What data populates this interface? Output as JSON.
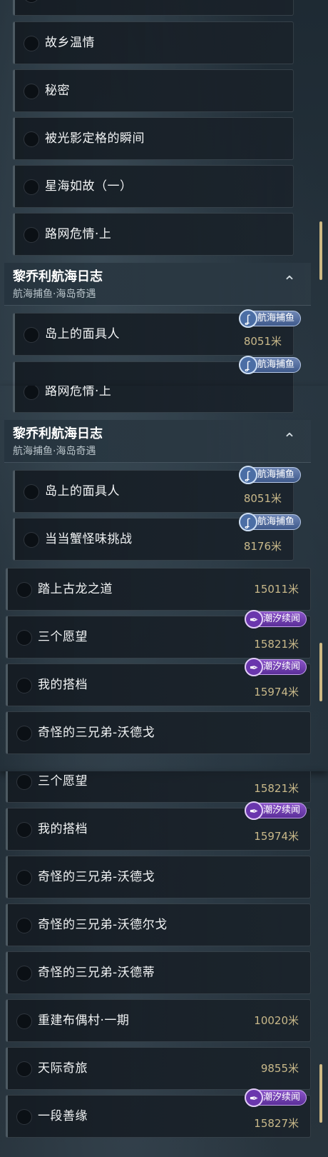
{
  "colors": {
    "accent_gold": "#c9b98a",
    "tide_purple": "#7a45b8",
    "fish_blue": "#4b6ea5"
  },
  "badges": {
    "fish": "航海捕鱼",
    "tide": "潮汐续闻",
    "fish_icon": "hook-icon",
    "tide_icon": "feather-icon"
  },
  "panel1": {
    "rows": [
      {
        "label": "故乡温情"
      },
      {
        "label": "秘密"
      },
      {
        "label": "被光影定格的瞬间"
      },
      {
        "label": "星海如故（一）"
      },
      {
        "label": "路网危情·上"
      }
    ],
    "section": {
      "title": "黎乔利航海日志",
      "subtitle": "航海捕鱼·海岛奇遇"
    },
    "after": [
      {
        "label": "岛上的面具人",
        "distance": "8051米"
      }
    ]
  },
  "panel2": {
    "rows": [
      {
        "label": "路网危情·上"
      }
    ],
    "section": {
      "title": "黎乔利航海日志",
      "subtitle": "航海捕鱼·海岛奇遇"
    },
    "after": [
      {
        "label": "岛上的面具人",
        "distance": "8051米"
      },
      {
        "label": "当当蟹怪味挑战",
        "distance": "8176米"
      }
    ],
    "more": [
      {
        "label": "踏上古龙之道",
        "distance": "15011米"
      },
      {
        "label": "三个愿望",
        "distance": "15821米"
      },
      {
        "label": "我的搭档",
        "distance": "15974米"
      },
      {
        "label": "奇怪的三兄弟-沃德戈"
      }
    ]
  },
  "panel3": {
    "rows": [
      {
        "label": "三个愿望",
        "distance": "15821米"
      },
      {
        "label": "我的搭档",
        "distance": "15974米"
      },
      {
        "label": "奇怪的三兄弟-沃德戈"
      },
      {
        "label": "奇怪的三兄弟-沃德尔戈"
      },
      {
        "label": "奇怪的三兄弟-沃德蒂"
      },
      {
        "label": "重建布偶村·一期",
        "distance": "10020米"
      },
      {
        "label": "天际奇旅",
        "distance": "9855米"
      },
      {
        "label": "一段善缘",
        "distance": "15827米"
      }
    ]
  }
}
